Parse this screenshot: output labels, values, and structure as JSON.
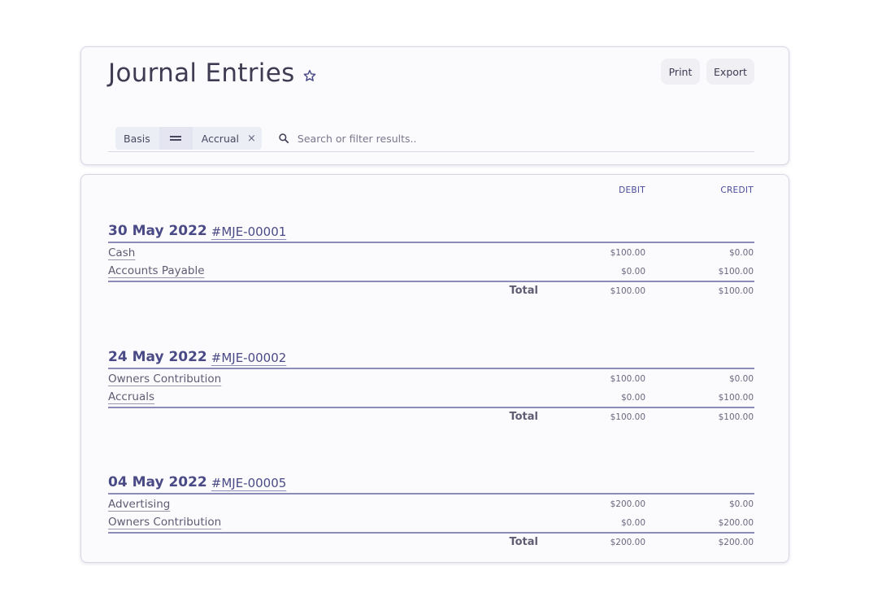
{
  "header": {
    "title": "Journal Entries",
    "favorite_icon": "star-icon",
    "print_label": "Print",
    "export_label": "Export"
  },
  "filter": {
    "field": "Basis",
    "operator_icon": "equals-icon",
    "value": "Accrual",
    "remove_label": "×",
    "search_placeholder": "Search or filter results.."
  },
  "columns": {
    "debit": "DEBIT",
    "credit": "CREDIT"
  },
  "entries": [
    {
      "date": "30 May 2022",
      "ref": "#MJE-00001",
      "lines": [
        {
          "account": "Cash",
          "debit": "$100.00",
          "credit": "$0.00"
        },
        {
          "account": "Accounts Payable",
          "debit": "$0.00",
          "credit": "$100.00"
        }
      ],
      "total_label": "Total",
      "total_debit": "$100.00",
      "total_credit": "$100.00"
    },
    {
      "date": "24 May 2022",
      "ref": "#MJE-00002",
      "lines": [
        {
          "account": "Owners Contribution",
          "debit": "$100.00",
          "credit": "$0.00"
        },
        {
          "account": "Accruals",
          "debit": "$0.00",
          "credit": "$100.00"
        }
      ],
      "total_label": "Total",
      "total_debit": "$100.00",
      "total_credit": "$100.00"
    },
    {
      "date": "04 May 2022",
      "ref": "#MJE-00005",
      "lines": [
        {
          "account": "Advertising",
          "debit": "$200.00",
          "credit": "$0.00"
        },
        {
          "account": "Owners Contribution",
          "debit": "$0.00",
          "credit": "$200.00"
        }
      ],
      "total_label": "Total",
      "total_debit": "$200.00",
      "total_credit": "$200.00"
    }
  ],
  "colors": {
    "accent": "#4a4a86",
    "rule": "#8c8cb8",
    "card_bg": "#fbfbfd"
  }
}
